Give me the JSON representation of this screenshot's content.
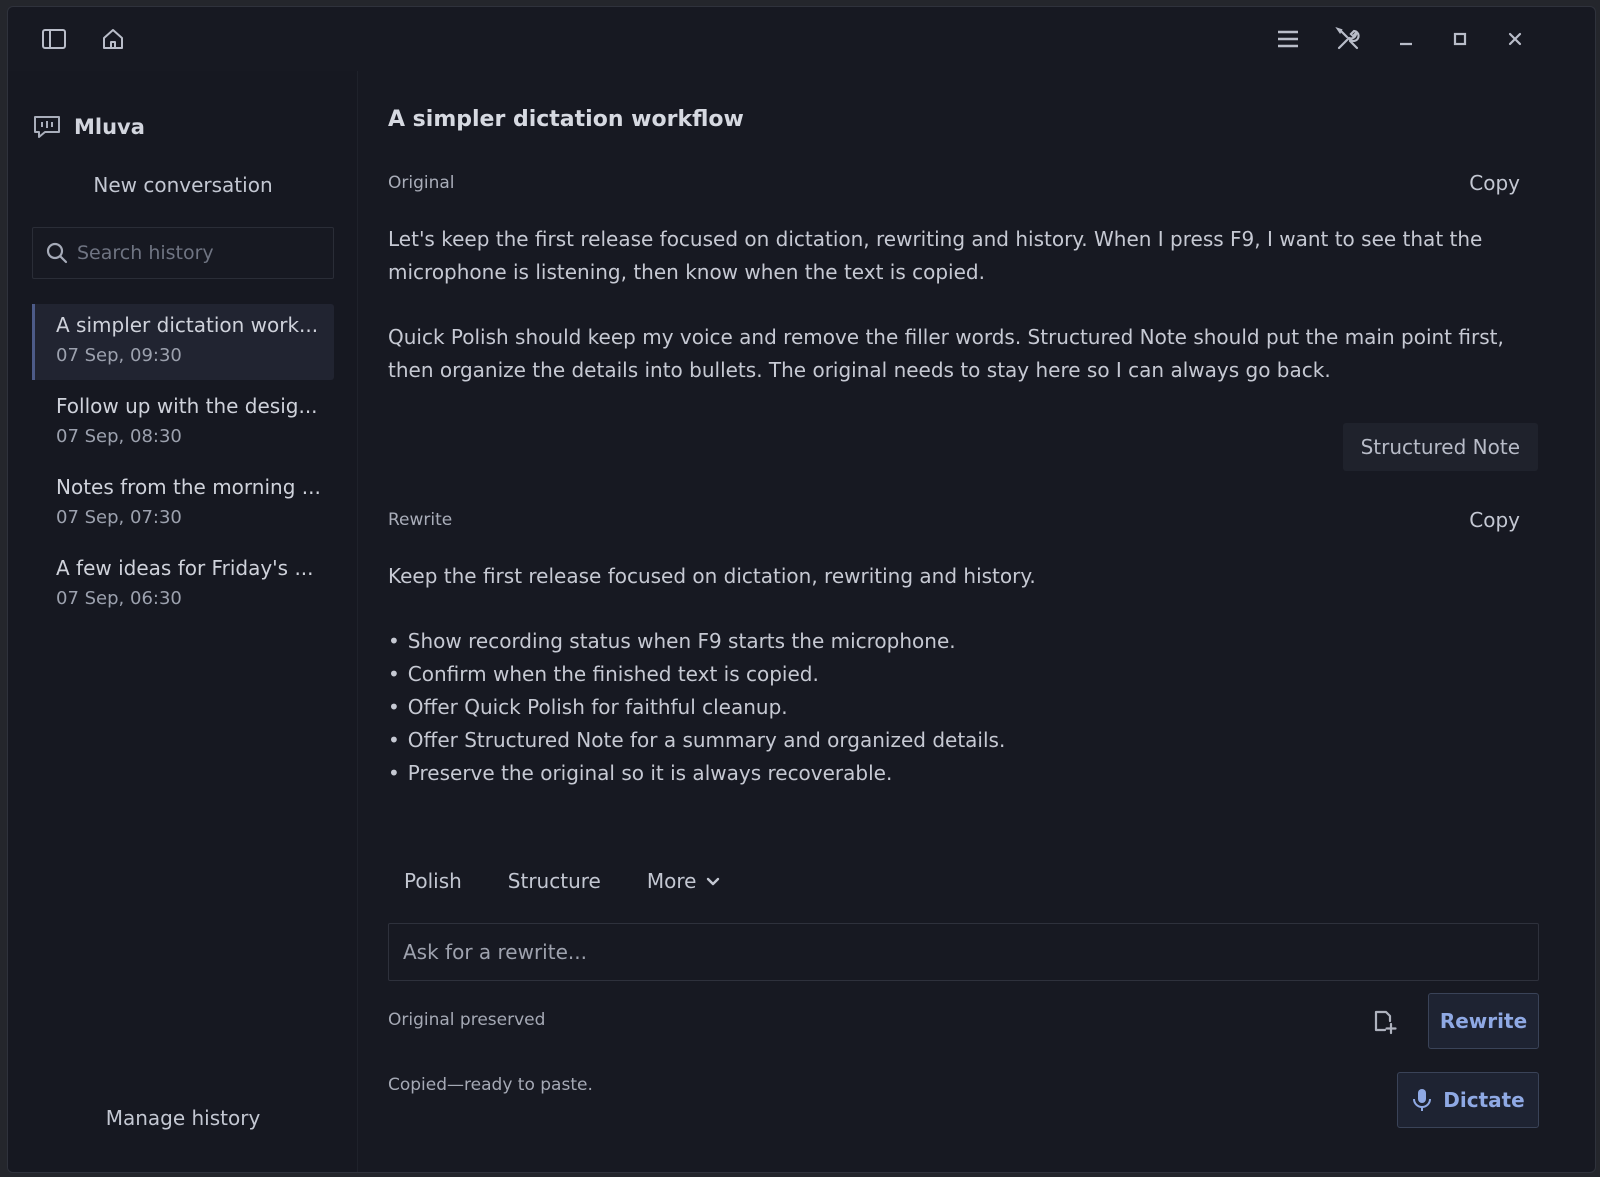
{
  "titlebar": {
    "icons": [
      "sidebar-toggle-icon",
      "home-icon",
      "menu-icon",
      "tools-icon",
      "minimize-icon",
      "maximize-icon",
      "close-icon"
    ]
  },
  "sidebar": {
    "brand": "Mluva",
    "new_conversation": "New conversation",
    "search_placeholder": "Search history",
    "history": [
      {
        "title": "A simpler dictation work...",
        "time": "07 Sep, 09:30",
        "active": true
      },
      {
        "title": "Follow up with the desig...",
        "time": "07 Sep, 08:30",
        "active": false
      },
      {
        "title": "Notes from the morning ...",
        "time": "07 Sep, 07:30",
        "active": false
      },
      {
        "title": "A few ideas for Friday's ...",
        "time": "07 Sep, 06:30",
        "active": false
      }
    ],
    "manage_history": "Manage history"
  },
  "main": {
    "title": "A simpler dictation workflow",
    "original": {
      "label": "Original",
      "copy": "Copy",
      "paragraphs": [
        "Let's keep the first release focused on dictation, rewriting and history. When I press F9, I want to see that the microphone is listening, then know when the text is copied.",
        "Quick Polish should keep my voice and remove the filler words. Structured Note should put the main point first, then organize the details into bullets. The original needs to stay here so I can always go back."
      ]
    },
    "mode_chip": "Structured Note",
    "rewrite": {
      "label": "Rewrite",
      "copy": "Copy",
      "intro": "Keep the first release focused on dictation, rewriting and history.",
      "bullets": [
        "Show recording status when F9 starts the microphone.",
        "Confirm when the finished text is copied.",
        "Offer Quick Polish for faithful cleanup.",
        "Offer Structured Note for a summary and organized details.",
        "Preserve the original so it is always recoverable."
      ]
    },
    "actions": {
      "polish": "Polish",
      "structure": "Structure",
      "more": "More"
    },
    "prompt_placeholder": "Ask for a rewrite...",
    "original_preserved": "Original preserved",
    "rewrite_button": "Rewrite",
    "status": "Copied—ready to paste.",
    "dictate_button": "Dictate"
  },
  "colors": {
    "background": "#171922",
    "accent": "#8fa9e4",
    "active_item": "#212431"
  }
}
